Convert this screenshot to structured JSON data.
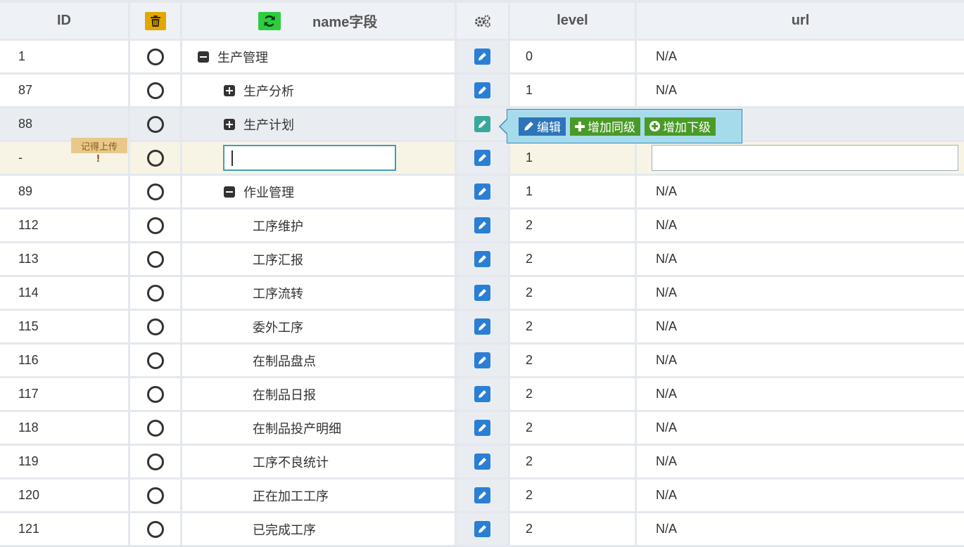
{
  "header": {
    "id": "ID",
    "name": "name字段",
    "level": "level",
    "url": "url",
    "delete_icon": "trash-icon",
    "refresh_icon": "refresh-icon",
    "settings_icon": "gears-icon"
  },
  "rows": [
    {
      "id": "1",
      "name": "生产管理",
      "level": "0",
      "url": "N/A",
      "toggle": "minus"
    },
    {
      "id": "87",
      "name": "生产分析",
      "level": "1",
      "url": "N/A",
      "toggle": "plus"
    },
    {
      "id": "88",
      "name": "生产计划",
      "level": "",
      "url": "",
      "toggle": "plus"
    },
    {
      "id": "-",
      "name": "",
      "level": "1",
      "url": ""
    },
    {
      "id": "89",
      "name": "作业管理",
      "level": "1",
      "url": "N/A",
      "toggle": "minus"
    },
    {
      "id": "112",
      "name": "工序维护",
      "level": "2",
      "url": "N/A"
    },
    {
      "id": "113",
      "name": "工序汇报",
      "level": "2",
      "url": "N/A"
    },
    {
      "id": "114",
      "name": "工序流转",
      "level": "2",
      "url": "N/A"
    },
    {
      "id": "115",
      "name": "委外工序",
      "level": "2",
      "url": "N/A"
    },
    {
      "id": "116",
      "name": "在制品盘点",
      "level": "2",
      "url": "N/A"
    },
    {
      "id": "117",
      "name": "在制品日报",
      "level": "2",
      "url": "N/A"
    },
    {
      "id": "118",
      "name": "在制品投产明细",
      "level": "2",
      "url": "N/A"
    },
    {
      "id": "119",
      "name": "工序不良统计",
      "level": "2",
      "url": "N/A"
    },
    {
      "id": "120",
      "name": "正在加工工序",
      "level": "2",
      "url": "N/A"
    },
    {
      "id": "121",
      "name": "已完成工序",
      "level": "2",
      "url": "N/A"
    }
  ],
  "new_row": {
    "tag": "记得上传",
    "warning": "!"
  },
  "popover": {
    "edit": "编辑",
    "add_sibling": "增加同级",
    "add_child": "增加下级"
  },
  "colors": {
    "edit_blue": "#2a7fd4",
    "edit_active": "#3aa89a",
    "trash": "#e0a800",
    "refresh": "#2ecc40",
    "popover_bg": "#a6dbec"
  }
}
